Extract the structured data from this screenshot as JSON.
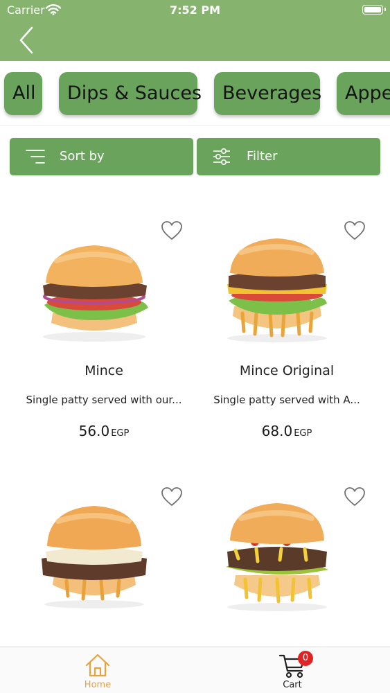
{
  "status_bar": {
    "carrier": "Carrier",
    "time": "7:52 PM"
  },
  "header": {
    "background": "#86b46e",
    "back_icon": "chevron-left-icon"
  },
  "categories": [
    {
      "label": "All"
    },
    {
      "label": "Dips & Sauces"
    },
    {
      "label": "Beverages"
    },
    {
      "label": "Appe"
    }
  ],
  "actions": {
    "sort": {
      "label": "Sort by",
      "icon": "sort-lines-icon"
    },
    "filter": {
      "label": "Filter",
      "icon": "sliders-icon"
    }
  },
  "products": [
    {
      "name": "Mince",
      "description": "Single patty served with our...",
      "price": "56.0",
      "currency": "EGP",
      "style": "classic"
    },
    {
      "name": "Mince Original",
      "description": "Single patty served with A...",
      "price": "68.0",
      "currency": "EGP",
      "style": "cheddar"
    },
    {
      "name": "",
      "description": "",
      "price": "",
      "currency": "",
      "style": "white-cheese"
    },
    {
      "name": "",
      "description": "",
      "price": "",
      "currency": "",
      "style": "chili"
    }
  ],
  "tabbar": {
    "home": {
      "label": "Home",
      "icon": "home-icon",
      "color": "#e8a33d"
    },
    "cart": {
      "label": "Cart",
      "icon": "cart-icon",
      "badge": "0"
    }
  },
  "colors": {
    "accent": "#6aa35c",
    "header": "#86b46e",
    "badge": "#e02424"
  }
}
